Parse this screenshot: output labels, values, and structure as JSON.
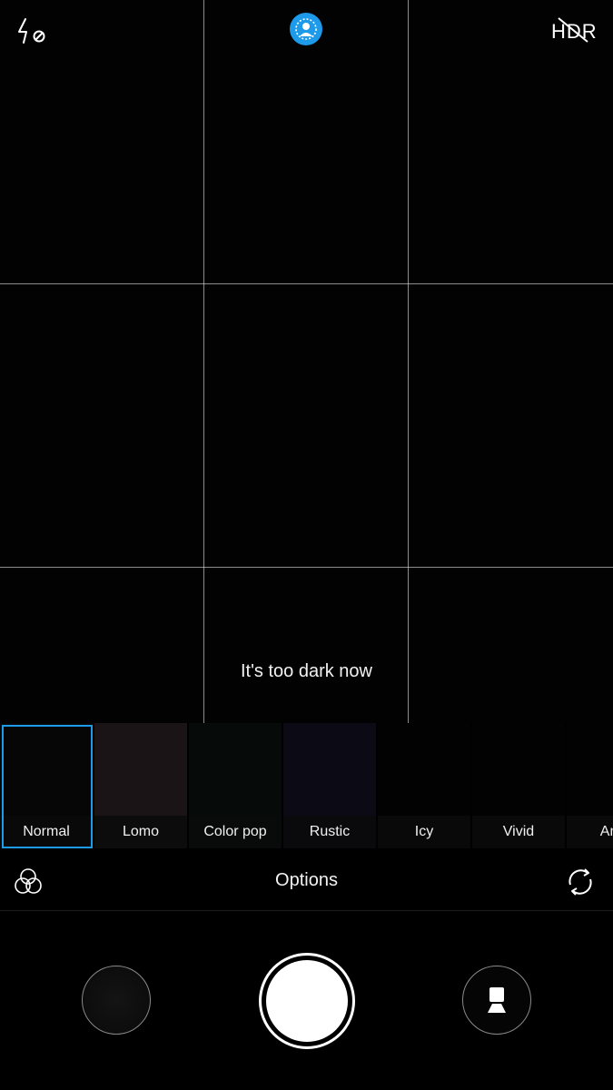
{
  "viewfinder": {
    "message": "It's too dark now",
    "flash_icon": "flash-off-icon",
    "beauty_icon": "beauty-mode-icon",
    "beauty_color": "#1d9bea",
    "hdr_icon": "hdr-off-icon",
    "hdr_label": "HDR"
  },
  "filters": {
    "selected": "Normal",
    "selection_color": "#1d9bea",
    "items": [
      {
        "label": "Normal",
        "thumb_color": "#060606"
      },
      {
        "label": "Lomo",
        "thumb_color": "#1a1416"
      },
      {
        "label": "Color pop",
        "thumb_color": "#060a09"
      },
      {
        "label": "Rustic",
        "thumb_color": "#0c0a14"
      },
      {
        "label": "Icy",
        "thumb_color": "#020202"
      },
      {
        "label": "Vivid",
        "thumb_color": "#020202"
      },
      {
        "label": "Ana",
        "thumb_color": "#020202"
      }
    ]
  },
  "options": {
    "label": "Options",
    "left_icon": "filters-icon",
    "right_icon": "switch-camera-icon"
  },
  "controls": {
    "gallery_icon": "gallery-thumbnail",
    "shutter_icon": "shutter-button",
    "mode_icon": "portrait-mode-icon"
  }
}
